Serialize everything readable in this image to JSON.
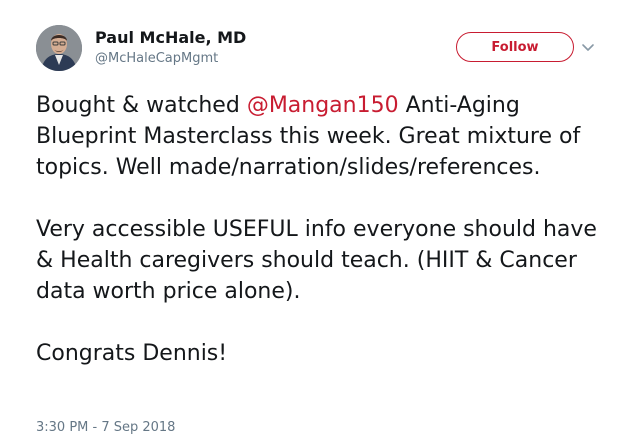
{
  "author": {
    "name": "Paul McHale, MD",
    "handle": "@McHaleCapMgmt",
    "avatar_icon": "profile-photo"
  },
  "actions": {
    "follow_label": "Follow",
    "more_icon": "chevron-down-icon"
  },
  "tweet": {
    "p1_before": "Bought & watched ",
    "mention": "@Mangan150",
    "p1_after": "  Anti-Aging Blueprint Masterclass this week. Great mixture of topics.  Well made/narration/slides/references.",
    "p2": "Very accessible USEFUL info everyone should have & Health caregivers should teach. (HIIT & Cancer data worth price alone).",
    "p3": "Congrats Dennis!"
  },
  "meta": {
    "timestamp": "3:30 PM - 7 Sep 2018"
  },
  "colors": {
    "accent": "#c81c31",
    "text": "#14171a",
    "muted": "#657786"
  }
}
